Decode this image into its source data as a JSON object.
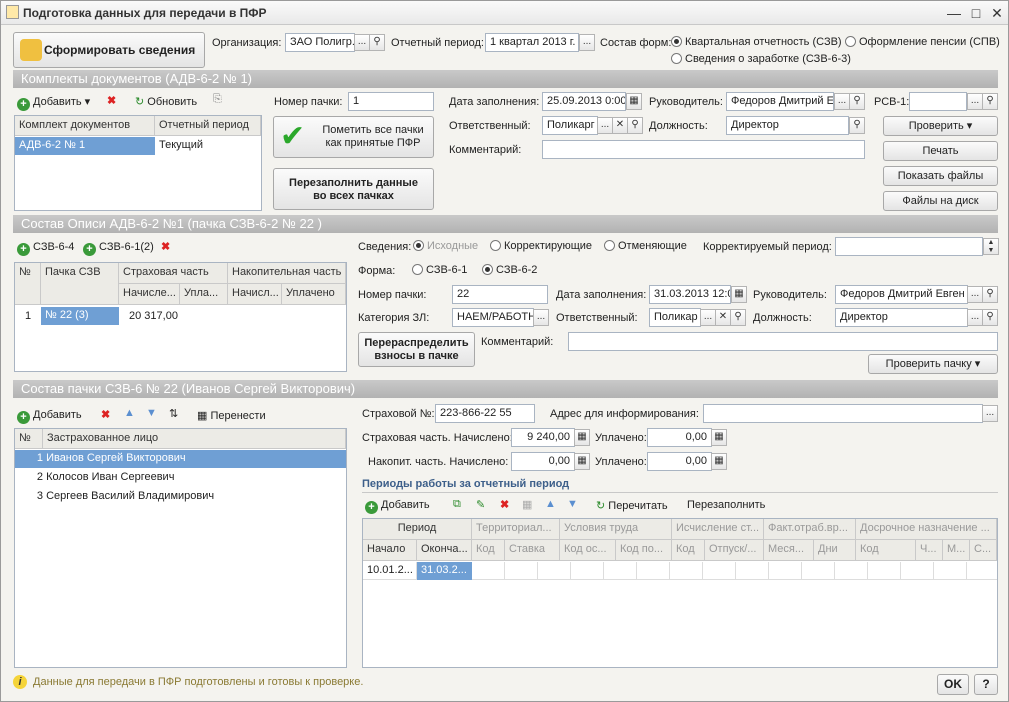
{
  "window": {
    "title": "Подготовка данных для передачи в ПФР"
  },
  "top": {
    "form_button": "Сформировать сведения",
    "org_label": "Организация:",
    "org_value": "ЗАО Полигр...",
    "period_label": "Отчетный период:",
    "period_value": "1 квартал 2013 г.",
    "forms_label": "Состав форм:",
    "forms_options": [
      "Квартальная отчетность (СЗВ)",
      "Оформление пенсии (СПВ)",
      "Сведения о заработке (СЗВ-6-3)"
    ]
  },
  "sec1": {
    "title": "Комплекты документов (АДВ-6-2 № 1)",
    "add": "Добавить",
    "refresh": "Обновить",
    "col_kit": "Комплект документов",
    "col_period": "Отчетный период",
    "row_kit": "АДВ-6-2 № 1",
    "row_period": "Текущий",
    "mark_button": "Пометить все пачки как принятые ПФР",
    "refill_button": "Перезаполнить данные во всех пачках",
    "pack_no_label": "Номер пачки:",
    "pack_no": "1",
    "fill_date_label": "Дата заполнения:",
    "fill_date": "25.09.2013 0:00",
    "head_label": "Руководитель:",
    "head": "Федоров Дмитрий Е",
    "rsv_label": "РСВ-1:",
    "resp_label": "Ответственный:",
    "resp": "Поликарг",
    "post_label": "Должность:",
    "post": "Директор",
    "comment_label": "Комментарий:",
    "check": "Проверить",
    "print": "Печать",
    "show_files": "Показать файлы",
    "files_disk": "Файлы на диск"
  },
  "sec2": {
    "title": "Состав Описи АДВ-6-2 №1 (пачка СЗВ-6-2 № 22 )",
    "add1": "СЗВ-6-4",
    "add2": "СЗВ-6-1(2)",
    "col_no": "№",
    "col_pack": "Пачка СЗВ",
    "col_ins": "Страховая часть",
    "col_acc": "Накопительная часть",
    "sub_acc1": "Начисле...",
    "sub_paid1": "Упла...",
    "sub_acc2": "Начисл...",
    "sub_paid2": "Уплачено",
    "row_no": "1",
    "row_pack": "№ 22 (3)",
    "row_sum": "20 317,00",
    "info_label": "Сведения:",
    "info_opts": [
      "Исходные",
      "Корректирующие",
      "Отменяющие"
    ],
    "corr_period_label": "Корректируемый период:",
    "form_label": "Форма:",
    "form_opts": [
      "СЗВ-6-1",
      "СЗВ-6-2"
    ],
    "pack_no_label": "Номер пачки:",
    "pack_no": "22",
    "fill_date_label": "Дата заполнения:",
    "fill_date": "31.03.2013 12:0",
    "head_label": "Руководитель:",
    "head": "Федоров Дмитрий Евген",
    "cat_label": "Категория ЗЛ:",
    "cat": "НАЕМ/РАБОТН",
    "resp_label": "Ответственный:",
    "resp": "Поликар",
    "post_label": "Должность:",
    "post": "Директор",
    "redistribute": "Перераспределить взносы в пачке",
    "comment_label": "Комментарий:",
    "check_pack": "Проверить пачку"
  },
  "sec3": {
    "title": "Состав пачки СЗВ-6 № 22 (Иванов Сергей Викторович)",
    "add": "Добавить",
    "move": "Перенести",
    "col_no": "№",
    "col_person": "Застрахованное лицо",
    "rows": [
      {
        "no": "1",
        "name": "Иванов Сергей Викторович"
      },
      {
        "no": "2",
        "name": "Колосов Иван Сергеевич"
      },
      {
        "no": "3",
        "name": "Сергеев Василий Владимирович"
      }
    ],
    "snils_label": "Страховой №:",
    "snils": "223-866-22 55",
    "addr_label": "Адрес для информирования:",
    "ins_label": "Страховая часть. Начислено:",
    "ins_acc": "9 240,00",
    "paid_label": "Уплачено:",
    "ins_paid": "0,00",
    "acc_label": "Накопит. часть. Начислено:",
    "acc_acc": "0,00",
    "acc_paid": "0,00",
    "periods_title": "Периоды работы за отчетный период",
    "add_period": "Добавить",
    "recalc": "Перечитать",
    "refill": "Перезаполнить",
    "h_period": "Период",
    "h_terr": "Территориал...",
    "h_cond": "Условия труда",
    "h_calc": "Исчисление ст...",
    "h_fact": "Факт.отраб.вр...",
    "h_early": "Досрочное назначение ...",
    "h_start": "Начало",
    "h_end": "Оконча...",
    "h_code1": "Код",
    "h_rate": "Ставка",
    "h_codeos": "Код ос...",
    "h_codepo": "Код по...",
    "h_code2": "Код",
    "h_leave": "Отпуск/...",
    "h_month": "Меся...",
    "h_days": "Дни",
    "h_code3": "Код",
    "h_ch": "Ч...",
    "h_m": "М...",
    "h_s": "С...",
    "r_start": "10.01.2...",
    "r_end": "31.03.2..."
  },
  "status": {
    "text": "Данные для передачи в ПФР подготовлены и готовы к проверке.",
    "ok": "OK",
    "help": "?"
  }
}
